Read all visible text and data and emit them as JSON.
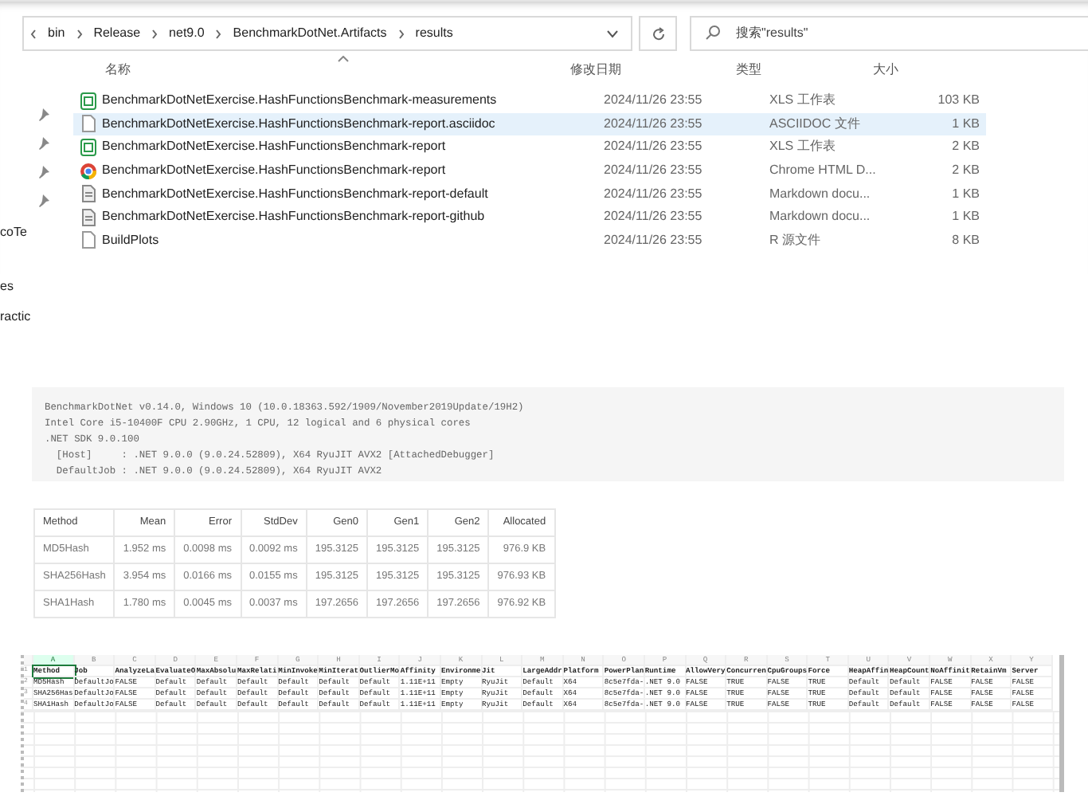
{
  "explorer": {
    "path": [
      "bin",
      "Release",
      "net9.0",
      "BenchmarkDotNet.Artifacts",
      "results"
    ],
    "search": {
      "placeholder": "搜索\"results\""
    },
    "columns": [
      "名称",
      "修改日期",
      "类型",
      "大小"
    ],
    "files": [
      {
        "name": "BenchmarkDotNetExercise.HashFunctionsBenchmark-measurements",
        "date": "2024/11/26 23:55",
        "type": "XLS 工作表",
        "size": "103 KB",
        "kind": "xls",
        "selected": false
      },
      {
        "name": "BenchmarkDotNetExercise.HashFunctionsBenchmark-report.asciidoc",
        "date": "2024/11/26 23:55",
        "type": "ASCIIDOC 文件",
        "size": "1 KB",
        "kind": "text",
        "selected": true
      },
      {
        "name": "BenchmarkDotNetExercise.HashFunctionsBenchmark-report",
        "date": "2024/11/26 23:55",
        "type": "XLS 工作表",
        "size": "2 KB",
        "kind": "xls",
        "selected": false
      },
      {
        "name": "BenchmarkDotNetExercise.HashFunctionsBenchmark-report",
        "date": "2024/11/26 23:55",
        "type": "Chrome HTML D...",
        "size": "2 KB",
        "kind": "chrome",
        "selected": false
      },
      {
        "name": "BenchmarkDotNetExercise.HashFunctionsBenchmark-report-default",
        "date": "2024/11/26 23:55",
        "type": "Markdown docu...",
        "size": "1 KB",
        "kind": "markdown",
        "selected": false
      },
      {
        "name": "BenchmarkDotNetExercise.HashFunctionsBenchmark-report-github",
        "date": "2024/11/26 23:55",
        "type": "Markdown docu...",
        "size": "1 KB",
        "kind": "markdown",
        "selected": false
      },
      {
        "name": "BuildPlots",
        "date": "2024/11/26 23:55",
        "type": "R 源文件",
        "size": "8 KB",
        "kind": "text",
        "selected": false
      }
    ],
    "sidebar_labels": [
      "coTe",
      "es",
      "ractic"
    ]
  },
  "code_block": {
    "lines": [
      "BenchmarkDotNet v0.14.0, Windows 10 (10.0.18363.592/1909/November2019Update/19H2)",
      "Intel Core i5-10400F CPU 2.90GHz, 1 CPU, 12 logical and 6 physical cores",
      ".NET SDK 9.0.100",
      "  [Host]     : .NET 9.0.0 (9.0.24.52809), X64 RyuJIT AVX2 [AttachedDebugger]",
      "  DefaultJob : .NET 9.0.0 (9.0.24.52809), X64 RyuJIT AVX2"
    ]
  },
  "results_table": {
    "columns": [
      "Method",
      "Mean",
      "Error",
      "StdDev",
      "Gen0",
      "Gen1",
      "Gen2",
      "Allocated"
    ],
    "rows": [
      [
        "MD5Hash",
        "1.952 ms",
        "0.0098 ms",
        "0.0092 ms",
        "195.3125",
        "195.3125",
        "195.3125",
        "976.9 KB"
      ],
      [
        "SHA256Hash",
        "3.954 ms",
        "0.0166 ms",
        "0.0155 ms",
        "195.3125",
        "195.3125",
        "195.3125",
        "976.93 KB"
      ],
      [
        "SHA1Hash",
        "1.780 ms",
        "0.0045 ms",
        "0.0037 ms",
        "197.2656",
        "197.2656",
        "197.2656",
        "976.92 KB"
      ]
    ]
  },
  "spreadsheet": {
    "columns": [
      {
        "letter": "A",
        "selected": true
      },
      {
        "letter": "B",
        "selected": false
      },
      {
        "letter": "C",
        "selected": false
      },
      {
        "letter": "D",
        "selected": false
      },
      {
        "letter": "E",
        "selected": false
      },
      {
        "letter": "F",
        "selected": false
      },
      {
        "letter": "G",
        "selected": false
      },
      {
        "letter": "H",
        "selected": false
      },
      {
        "letter": "I",
        "selected": false
      },
      {
        "letter": "J",
        "selected": false
      },
      {
        "letter": "K",
        "selected": false
      },
      {
        "letter": "L",
        "selected": false
      },
      {
        "letter": "M",
        "selected": false
      },
      {
        "letter": "N",
        "selected": false
      },
      {
        "letter": "O",
        "selected": false
      },
      {
        "letter": "P",
        "selected": false
      },
      {
        "letter": "Q",
        "selected": false
      },
      {
        "letter": "R",
        "selected": false
      },
      {
        "letter": "S",
        "selected": false
      },
      {
        "letter": "T",
        "selected": false
      },
      {
        "letter": "U",
        "selected": false
      },
      {
        "letter": "V",
        "selected": false
      },
      {
        "letter": "W",
        "selected": false
      },
      {
        "letter": "X",
        "selected": false
      },
      {
        "letter": "Y",
        "selected": false
      }
    ],
    "rows": [
      [
        "Method",
        "Job",
        "AnalyzeLa",
        "EvaluateO",
        "MaxAbsolu",
        "MaxRelati",
        "MinInvoke",
        "MinIterat",
        "OutlierMo",
        "Affinity",
        "Environme",
        "Jit",
        "LargeAddr",
        "Platform",
        "PowerPlan",
        "Runtime",
        "AllowVery",
        "Concurren",
        "CpuGroups",
        "Force",
        "HeapAffin",
        "HeapCount",
        "NoAffinit",
        "RetainVm",
        "Server"
      ],
      [
        "MD5Hash",
        "DefaultJo",
        "FALSE",
        "Default",
        "Default",
        "Default",
        "Default",
        "Default",
        "Default",
        "1.11E+11",
        "Empty",
        "RyuJit",
        "Default",
        "X64",
        "8c5e7fda-",
        ".NET 9.0",
        "FALSE",
        "TRUE",
        "FALSE",
        "TRUE",
        "Default",
        "Default",
        "FALSE",
        "FALSE",
        "FALSE"
      ],
      [
        "SHA256Has",
        "DefaultJo",
        "FALSE",
        "Default",
        "Default",
        "Default",
        "Default",
        "Default",
        "Default",
        "1.11E+11",
        "Empty",
        "RyuJit",
        "Default",
        "X64",
        "8c5e7fda-",
        ".NET 9.0",
        "FALSE",
        "TRUE",
        "FALSE",
        "TRUE",
        "Default",
        "Default",
        "FALSE",
        "FALSE",
        "FALSE"
      ],
      [
        "SHA1Hash",
        "DefaultJo",
        "FALSE",
        "Default",
        "Default",
        "Default",
        "Default",
        "Default",
        "Default",
        "1.11E+11",
        "Empty",
        "RyuJit",
        "Default",
        "X64",
        "8c5e7fda-",
        ".NET 9.0",
        "FALSE",
        "TRUE",
        "FALSE",
        "TRUE",
        "Default",
        "Default",
        "FALSE",
        "FALSE",
        "FALSE"
      ]
    ],
    "row_numbers": [
      "1",
      "2",
      "3",
      "4"
    ]
  }
}
